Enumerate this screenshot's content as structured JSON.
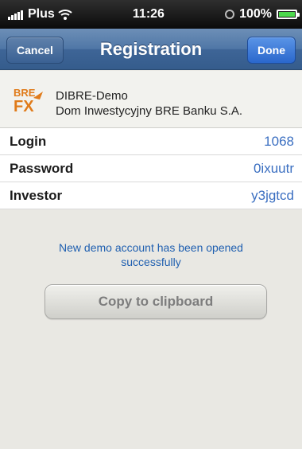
{
  "status_bar": {
    "carrier": "Plus",
    "time": "11:26",
    "battery": "100%"
  },
  "nav": {
    "title": "Registration",
    "cancel_label": "Cancel",
    "done_label": "Done"
  },
  "broker": {
    "logo_text_top": "BRE",
    "logo_text_bottom": "FX",
    "name": "DIBRE-Demo",
    "company": "Dom Inwestycyjny BRE Banku S.A."
  },
  "credentials": [
    {
      "label": "Login",
      "value": "1068"
    },
    {
      "label": "Password",
      "value": "0ixuutr"
    },
    {
      "label": "Investor",
      "value": "y3jgtcd"
    }
  ],
  "message": "New demo account has been opened successfully",
  "copy_button_label": "Copy to clipboard",
  "colors": {
    "navbar": "#4f76a6",
    "value_text": "#3b6fc1",
    "message_text": "#1f5fb0"
  }
}
